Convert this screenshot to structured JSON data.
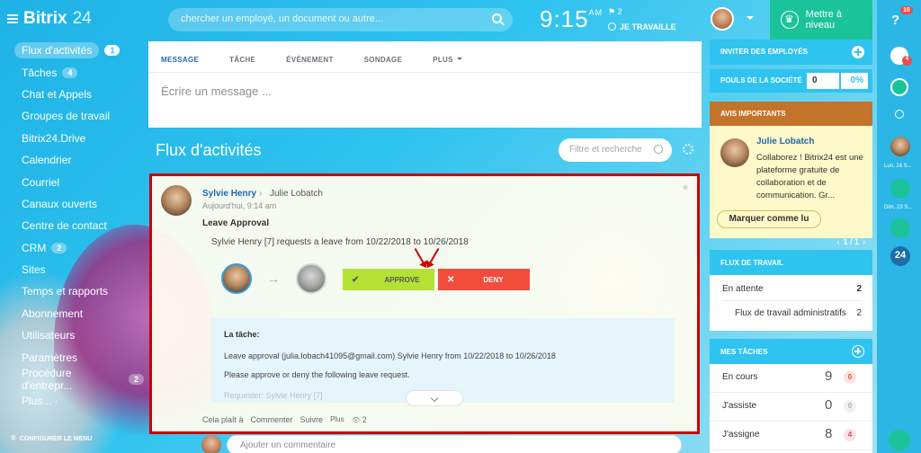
{
  "app": {
    "logo_name": "Bitrix",
    "logo_num": "24"
  },
  "search": {
    "placeholder": "chercher un employé, un document ou autre..."
  },
  "clock": {
    "time": "9:15",
    "ampm": "AM",
    "flag_count": "2",
    "work_status": "JE TRAVAILLE"
  },
  "upgrade_label": "Mettre à niveau",
  "menu": {
    "items": [
      {
        "label": "Flux d'activités",
        "badge": "1"
      },
      {
        "label": "Tâches",
        "badge": "4"
      },
      {
        "label": "Chat et Appels"
      },
      {
        "label": "Groupes de travail"
      },
      {
        "label": "Bitrix24.Drive"
      },
      {
        "label": "Calendrier"
      },
      {
        "label": "Courriel"
      },
      {
        "label": "Canaux ouverts"
      },
      {
        "label": "Centre de contact"
      },
      {
        "label": "CRM",
        "badge": "2"
      },
      {
        "label": "Sites"
      },
      {
        "label": "Temps et rapports"
      },
      {
        "label": "Abonnement"
      },
      {
        "label": "Utilisateurs"
      },
      {
        "label": "Paramètres"
      },
      {
        "label": "Procédure d'entrepr...",
        "badge": "2"
      },
      {
        "label": "Plus... ·"
      }
    ],
    "footer": "CONFIGURER LE MENU"
  },
  "composer": {
    "tabs": [
      "MESSAGE",
      "TÂCHE",
      "ÉVÉNEMENT",
      "SONDAGE",
      "PLUS"
    ],
    "placeholder": "Écrire un message ..."
  },
  "feed": {
    "title": "Flux d'activités",
    "filter_placeholder": "Filtre et recherche"
  },
  "post": {
    "author": "Sylvie Henry",
    "separator": "›",
    "destination": "Julie Lobatch",
    "time": "Aujourd'hui, 9:14 am",
    "title": "Leave Approval",
    "text": "Sylvie Henry [7] requests a leave from 10/22/2018 to 10/26/2018",
    "approve_label": "APPROVE",
    "deny_label": "DENY",
    "task_label": "La tâche:",
    "task_line1": "Leave approval (julia.lobach41095@gmail.com) Sylvie Henry from 10/22/2018 to 10/26/2018",
    "task_line2": "Please approve or deny the following leave request.",
    "task_line3": "Requester: Sylvie Henry [7]",
    "actions": {
      "like": "Cela plaît à",
      "comment": "Commenter",
      "follow": "Suivre",
      "more": "Plus",
      "views": "2"
    }
  },
  "comment": {
    "placeholder": "Ajouter un commentaire"
  },
  "right": {
    "invite": "INVITER DES EMPLOYÉS",
    "pulse": {
      "label": "POULS DE LA SOCIÉTÉ",
      "value": "0",
      "percent": "0%"
    },
    "notice": {
      "header": "AVIS IMPORTANTS",
      "name": "Julie Lobatch",
      "text": "Collaborez ! Bitrix24 est une plateforme gratuite de collaboration et de communication. Gr...",
      "button": "Marquer comme lu",
      "pager": "1 / 1"
    },
    "workflow": {
      "header": "FLUX DE TRAVAIL",
      "row1_label": "En attente",
      "row1_value": "2",
      "row2_label": "Flux de travail administratifs",
      "row2_value": "2"
    },
    "tasks": {
      "header": "MES TÂCHES",
      "rows": [
        {
          "label": "En cours",
          "count": "9",
          "badge": "0"
        },
        {
          "label": "J'assiste",
          "count": "0",
          "badge": "0"
        },
        {
          "label": "J'assigne",
          "count": "8",
          "badge": "4"
        }
      ]
    }
  },
  "rail": {
    "help_badge": "10",
    "bell_badge": "4",
    "label1": "Lun, 24 S...",
    "label2": "Dim, 23 S...",
    "counter": "24"
  }
}
